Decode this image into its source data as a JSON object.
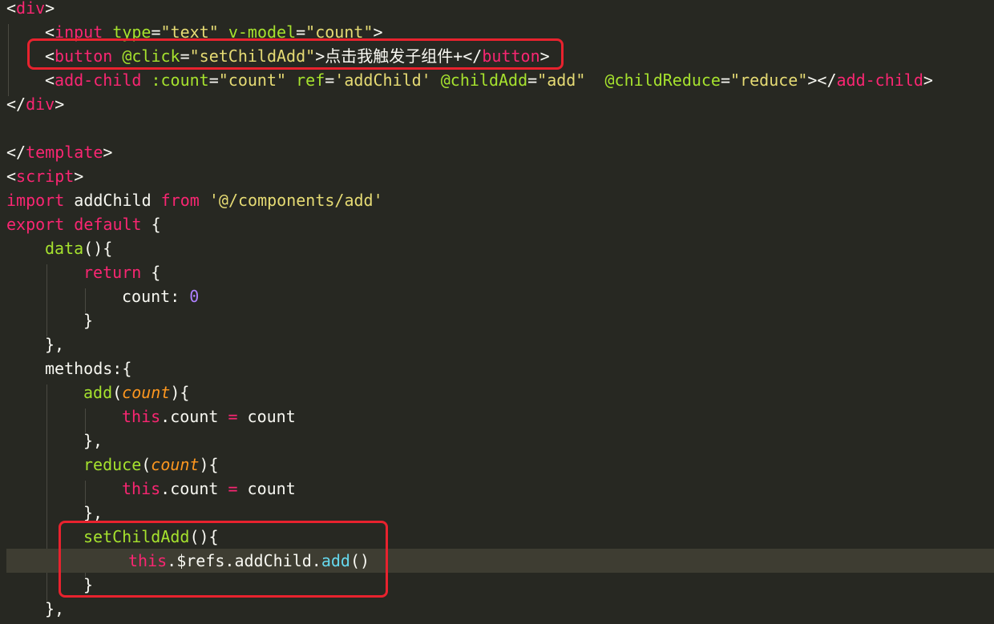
{
  "colors": {
    "background": "#272822",
    "current_line": "#3e3d32",
    "tag": "#f92672",
    "attribute": "#a6e22e",
    "string": "#e6db74",
    "keyword": "#f92672",
    "function": "#a6e22e",
    "parameter": "#fd971f",
    "number": "#ae81ff",
    "property": "#66d9ef",
    "text": "#f8f8f2",
    "annotation_box": "#e8222e"
  },
  "editor": {
    "highlighted_line": 23,
    "annotations": [
      "button-line-annotation",
      "setChildAdd-method-annotation"
    ],
    "lines": [
      [
        [
          "<",
          "t-punct"
        ],
        [
          "div",
          "t-tag"
        ],
        [
          ">",
          "t-punct"
        ]
      ],
      [
        [
          "<",
          "t-punct"
        ],
        [
          "input",
          "t-tag"
        ],
        [
          " ",
          "t-plain"
        ],
        [
          "type",
          "t-attr"
        ],
        [
          "=",
          "t-punct"
        ],
        [
          "\"text\"",
          "t-str"
        ],
        [
          " ",
          "t-plain"
        ],
        [
          "v-model",
          "t-attr"
        ],
        [
          "=",
          "t-punct"
        ],
        [
          "\"count\"",
          "t-str"
        ],
        [
          ">",
          "t-punct"
        ]
      ],
      [
        [
          "<",
          "t-punct"
        ],
        [
          "button",
          "t-tag"
        ],
        [
          " ",
          "t-plain"
        ],
        [
          "@click",
          "t-attr"
        ],
        [
          "=",
          "t-punct"
        ],
        [
          "\"setChildAdd\"",
          "t-str"
        ],
        [
          ">点击我触发子组件+</",
          "t-punct"
        ],
        [
          "button",
          "t-tag"
        ],
        [
          ">",
          "t-punct"
        ]
      ],
      [
        [
          "<",
          "t-punct"
        ],
        [
          "add-child",
          "t-tag"
        ],
        [
          " ",
          "t-plain"
        ],
        [
          ":count",
          "t-attr"
        ],
        [
          "=",
          "t-punct"
        ],
        [
          "\"count\"",
          "t-str"
        ],
        [
          " ",
          "t-plain"
        ],
        [
          "ref",
          "t-attr"
        ],
        [
          "=",
          "t-punct"
        ],
        [
          "'addChild'",
          "t-str"
        ],
        [
          " ",
          "t-plain"
        ],
        [
          "@childAdd",
          "t-attr"
        ],
        [
          "=",
          "t-punct"
        ],
        [
          "\"add\"",
          "t-str"
        ],
        [
          "  ",
          "t-plain"
        ],
        [
          "@childReduce",
          "t-attr"
        ],
        [
          "=",
          "t-punct"
        ],
        [
          "\"reduce\"",
          "t-str"
        ],
        [
          "></",
          "t-punct"
        ],
        [
          "add-child",
          "t-tag"
        ],
        [
          ">",
          "t-punct"
        ]
      ],
      [
        [
          "</",
          "t-punct"
        ],
        [
          "div",
          "t-tag"
        ],
        [
          ">",
          "t-punct"
        ]
      ],
      [],
      [
        [
          "</",
          "t-punct"
        ],
        [
          "template",
          "t-tag"
        ],
        [
          ">",
          "t-punct"
        ]
      ],
      [
        [
          "<",
          "t-punct"
        ],
        [
          "script",
          "t-tag"
        ],
        [
          ">",
          "t-punct"
        ]
      ],
      [
        [
          "import",
          "t-kw"
        ],
        [
          " addChild ",
          "t-plain"
        ],
        [
          "from",
          "t-kw"
        ],
        [
          " ",
          "t-plain"
        ],
        [
          "'@/components/add'",
          "t-str"
        ]
      ],
      [
        [
          "export",
          "t-kw"
        ],
        [
          " ",
          "t-plain"
        ],
        [
          "default",
          "t-kw"
        ],
        [
          " {",
          "t-plain"
        ]
      ],
      [
        [
          "data",
          "t-fn"
        ],
        [
          "(){",
          "t-plain"
        ]
      ],
      [
        [
          "return",
          "t-kw"
        ],
        [
          " {",
          "t-plain"
        ]
      ],
      [
        [
          "count: ",
          "t-plain"
        ],
        [
          "0",
          "t-num"
        ]
      ],
      [
        [
          "}",
          "t-plain"
        ]
      ],
      [
        [
          "},",
          "t-plain"
        ]
      ],
      [
        [
          "methods:{",
          "t-plain"
        ]
      ],
      [
        [
          "add",
          "t-fn"
        ],
        [
          "(",
          "t-plain"
        ],
        [
          "count",
          "t-param"
        ],
        [
          "){",
          "t-plain"
        ]
      ],
      [
        [
          "this",
          "t-kw"
        ],
        [
          ".count ",
          "t-plain"
        ],
        [
          "=",
          "t-kw"
        ],
        [
          " count",
          "t-plain"
        ]
      ],
      [
        [
          "},",
          "t-plain"
        ]
      ],
      [
        [
          "reduce",
          "t-fn"
        ],
        [
          "(",
          "t-plain"
        ],
        [
          "count",
          "t-param"
        ],
        [
          "){",
          "t-plain"
        ]
      ],
      [
        [
          "this",
          "t-kw"
        ],
        [
          ".count ",
          "t-plain"
        ],
        [
          "=",
          "t-kw"
        ],
        [
          " count",
          "t-plain"
        ]
      ],
      [
        [
          "},",
          "t-plain"
        ]
      ],
      [
        [
          "setChildAdd",
          "t-fn"
        ],
        [
          "(){",
          "t-plain"
        ]
      ],
      [
        [
          "this",
          "t-kw"
        ],
        [
          ".$refs.addChild.",
          "t-plain"
        ],
        [
          "add",
          "t-prop"
        ],
        [
          "()",
          "t-plain"
        ]
      ],
      [
        [
          "}",
          "t-plain"
        ]
      ],
      [
        [
          "},",
          "t-plain"
        ]
      ]
    ]
  }
}
